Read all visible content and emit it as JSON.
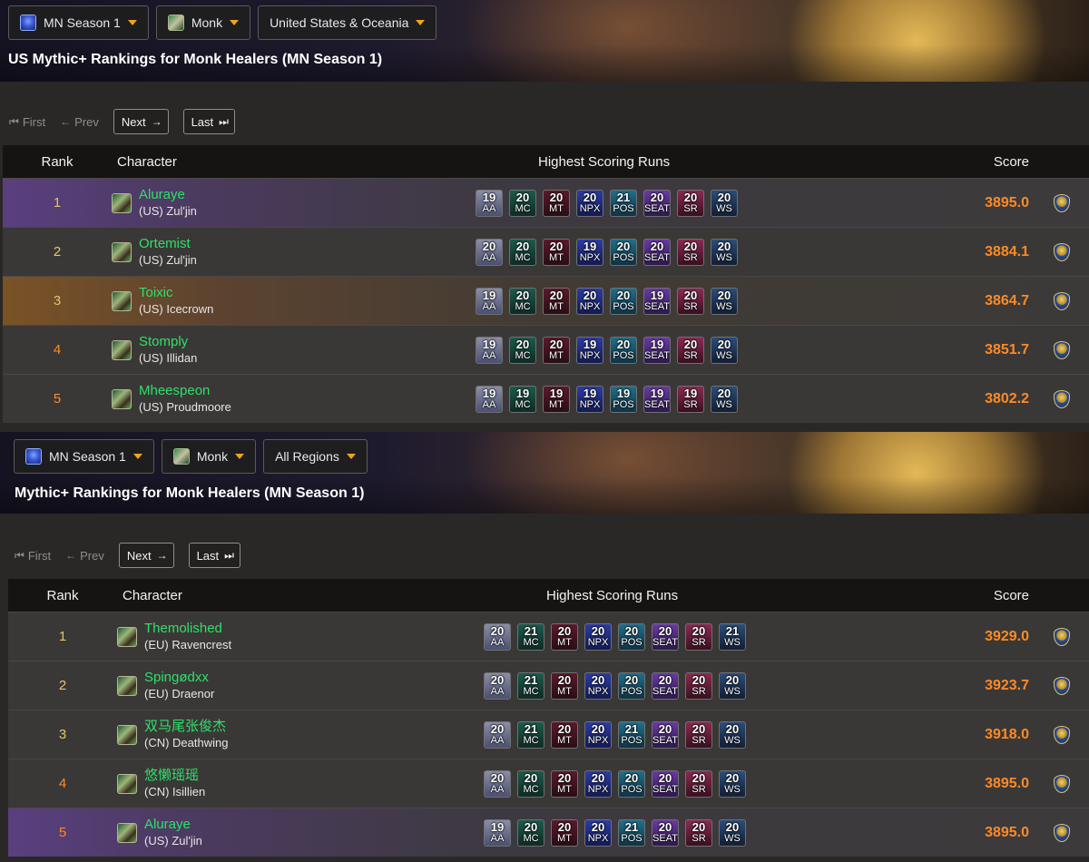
{
  "panels": [
    {
      "filters": {
        "season": "MN Season 1",
        "class": "Monk",
        "region": "United States & Oceania"
      },
      "title": "US Mythic+ Rankings for Monk Healers (MN Season 1)",
      "pager": {
        "first": "First",
        "prev": "Prev",
        "next": "Next",
        "last": "Last"
      },
      "headers": {
        "rank": "Rank",
        "character": "Character",
        "runs": "Highest Scoring Runs",
        "score": "Score"
      },
      "rows": [
        {
          "rank": "1",
          "name": "Aluraye",
          "realm": "(US) Zul'jin",
          "score": "3895.0",
          "runs": [
            [
              "19",
              "AA"
            ],
            [
              "20",
              "MC"
            ],
            [
              "20",
              "MT"
            ],
            [
              "20",
              "NPX"
            ],
            [
              "21",
              "POS"
            ],
            [
              "20",
              "SEAT"
            ],
            [
              "20",
              "SR"
            ],
            [
              "20",
              "WS"
            ]
          ]
        },
        {
          "rank": "2",
          "name": "Ortemist",
          "realm": "(US) Zul'jin",
          "score": "3884.1",
          "runs": [
            [
              "20",
              "AA"
            ],
            [
              "20",
              "MC"
            ],
            [
              "20",
              "MT"
            ],
            [
              "19",
              "NPX"
            ],
            [
              "20",
              "POS"
            ],
            [
              "20",
              "SEAT"
            ],
            [
              "20",
              "SR"
            ],
            [
              "20",
              "WS"
            ]
          ]
        },
        {
          "rank": "3",
          "name": "Toixic",
          "realm": "(US) Icecrown",
          "score": "3864.7",
          "runs": [
            [
              "19",
              "AA"
            ],
            [
              "20",
              "MC"
            ],
            [
              "20",
              "MT"
            ],
            [
              "20",
              "NPX"
            ],
            [
              "20",
              "POS"
            ],
            [
              "19",
              "SEAT"
            ],
            [
              "20",
              "SR"
            ],
            [
              "20",
              "WS"
            ]
          ]
        },
        {
          "rank": "4",
          "name": "Stomply",
          "realm": "(US) Illidan",
          "score": "3851.7",
          "runs": [
            [
              "19",
              "AA"
            ],
            [
              "20",
              "MC"
            ],
            [
              "20",
              "MT"
            ],
            [
              "19",
              "NPX"
            ],
            [
              "20",
              "POS"
            ],
            [
              "19",
              "SEAT"
            ],
            [
              "20",
              "SR"
            ],
            [
              "20",
              "WS"
            ]
          ]
        },
        {
          "rank": "5",
          "name": "Mheespeon",
          "realm": "(US) Proudmoore",
          "score": "3802.2",
          "runs": [
            [
              "19",
              "AA"
            ],
            [
              "19",
              "MC"
            ],
            [
              "19",
              "MT"
            ],
            [
              "19",
              "NPX"
            ],
            [
              "19",
              "POS"
            ],
            [
              "19",
              "SEAT"
            ],
            [
              "19",
              "SR"
            ],
            [
              "20",
              "WS"
            ]
          ]
        }
      ]
    },
    {
      "filters": {
        "season": "MN Season 1",
        "class": "Monk",
        "region": "All Regions"
      },
      "title": "Mythic+ Rankings for Monk Healers (MN Season 1)",
      "pager": {
        "first": "First",
        "prev": "Prev",
        "next": "Next",
        "last": "Last"
      },
      "headers": {
        "rank": "Rank",
        "character": "Character",
        "runs": "Highest Scoring Runs",
        "score": "Score"
      },
      "rows": [
        {
          "rank": "1",
          "name": "Themolished",
          "realm": "(EU) Ravencrest",
          "score": "3929.0",
          "runs": [
            [
              "20",
              "AA"
            ],
            [
              "21",
              "MC"
            ],
            [
              "20",
              "MT"
            ],
            [
              "20",
              "NPX"
            ],
            [
              "20",
              "POS"
            ],
            [
              "20",
              "SEAT"
            ],
            [
              "20",
              "SR"
            ],
            [
              "21",
              "WS"
            ]
          ]
        },
        {
          "rank": "2",
          "name": "Spingødxx",
          "realm": "(EU) Draenor",
          "score": "3923.7",
          "runs": [
            [
              "20",
              "AA"
            ],
            [
              "21",
              "MC"
            ],
            [
              "20",
              "MT"
            ],
            [
              "20",
              "NPX"
            ],
            [
              "20",
              "POS"
            ],
            [
              "20",
              "SEAT"
            ],
            [
              "20",
              "SR"
            ],
            [
              "20",
              "WS"
            ]
          ]
        },
        {
          "rank": "3",
          "name": "双马尾张俊杰",
          "realm": "(CN) Deathwing",
          "score": "3918.0",
          "runs": [
            [
              "20",
              "AA"
            ],
            [
              "21",
              "MC"
            ],
            [
              "20",
              "MT"
            ],
            [
              "20",
              "NPX"
            ],
            [
              "21",
              "POS"
            ],
            [
              "20",
              "SEAT"
            ],
            [
              "20",
              "SR"
            ],
            [
              "20",
              "WS"
            ]
          ]
        },
        {
          "rank": "4",
          "name": "悠懒瑶瑶",
          "realm": "(CN) Isillien",
          "score": "3895.0",
          "runs": [
            [
              "20",
              "AA"
            ],
            [
              "20",
              "MC"
            ],
            [
              "20",
              "MT"
            ],
            [
              "20",
              "NPX"
            ],
            [
              "20",
              "POS"
            ],
            [
              "20",
              "SEAT"
            ],
            [
              "20",
              "SR"
            ],
            [
              "20",
              "WS"
            ]
          ]
        },
        {
          "rank": "5",
          "name": "Aluraye",
          "realm": "(US) Zul'jin",
          "score": "3895.0",
          "runs": [
            [
              "19",
              "AA"
            ],
            [
              "20",
              "MC"
            ],
            [
              "20",
              "MT"
            ],
            [
              "20",
              "NPX"
            ],
            [
              "21",
              "POS"
            ],
            [
              "20",
              "SEAT"
            ],
            [
              "20",
              "SR"
            ],
            [
              "20",
              "WS"
            ]
          ]
        }
      ]
    }
  ],
  "colors": {
    "name": "#2ee06a",
    "score": "#ff8a26",
    "rank_gold": "#e6c46a",
    "caret": "#f0a418"
  }
}
